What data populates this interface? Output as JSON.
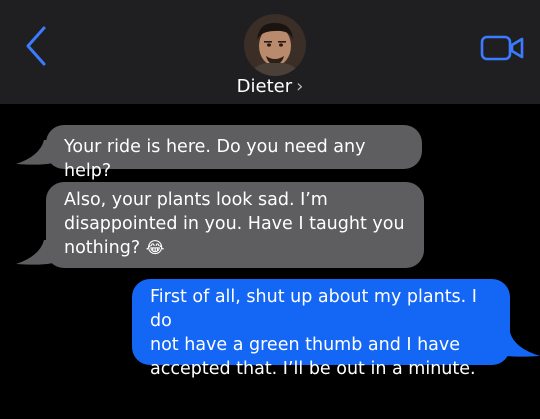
{
  "header": {
    "contact_name": "Dieter",
    "name_chevron": "›",
    "back_icon": "chevron-left-icon",
    "video_icon": "video-camera-icon",
    "accent_color": "#3a7bff",
    "background_color": "#1f1f21"
  },
  "messages": [
    {
      "direction": "incoming",
      "text": "Your ride is here. Do you need any help?"
    },
    {
      "direction": "incoming",
      "text_lines": [
        "Also, your plants look sad. I’m",
        "disappointed in you. Have I taught you",
        "nothing?"
      ],
      "emoji": "😂"
    },
    {
      "direction": "outgoing",
      "text_lines": [
        "First of all, shut up about my plants. I do",
        "not have a green thumb and I have",
        "accepted that. I’ll be out in a minute."
      ]
    }
  ],
  "colors": {
    "incoming_bubble": "#5e5e60",
    "outgoing_bubble": "#1466f5",
    "page_background": "#000000"
  }
}
